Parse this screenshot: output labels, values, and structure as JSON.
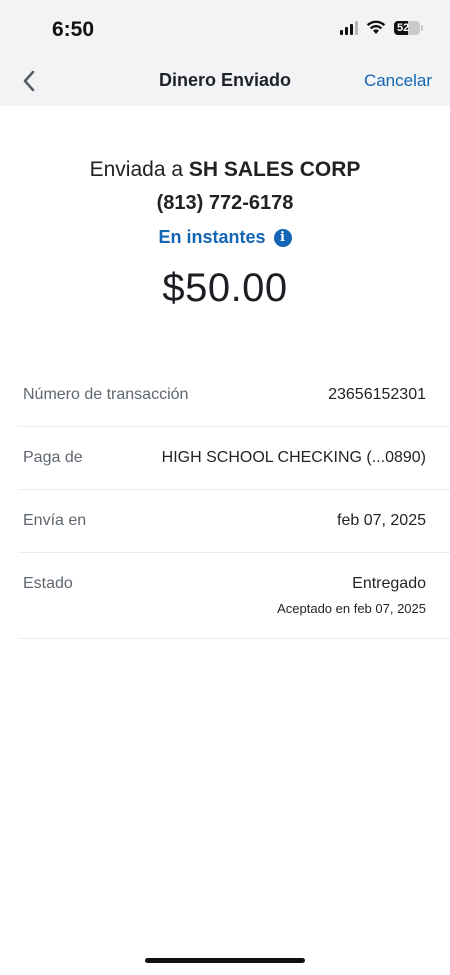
{
  "status_bar": {
    "time": "6:50",
    "battery_level": "52"
  },
  "nav": {
    "title": "Dinero Enviado",
    "cancel_label": "Cancelar"
  },
  "hero": {
    "sent_prefix": "Enviada a",
    "recipient": "SH SALES CORP",
    "phone": "(813) 772-6178",
    "speed_label": "En instantes",
    "amount": "$50.00"
  },
  "details": {
    "transaction_label": "Número de transacción",
    "transaction_value": "23656152301",
    "from_label": "Paga de",
    "from_value": "HIGH SCHOOL CHECKING (...0890)",
    "send_date_label": "Envía en",
    "send_date_value": "feb 07, 2025",
    "status_label": "Estado",
    "status_value": "Entregado",
    "status_sub": "Aceptado en feb 07, 2025"
  },
  "colors": {
    "accent": "#1366b3",
    "header_bg": "#f2f3f5",
    "divider": "#e9ebee"
  }
}
